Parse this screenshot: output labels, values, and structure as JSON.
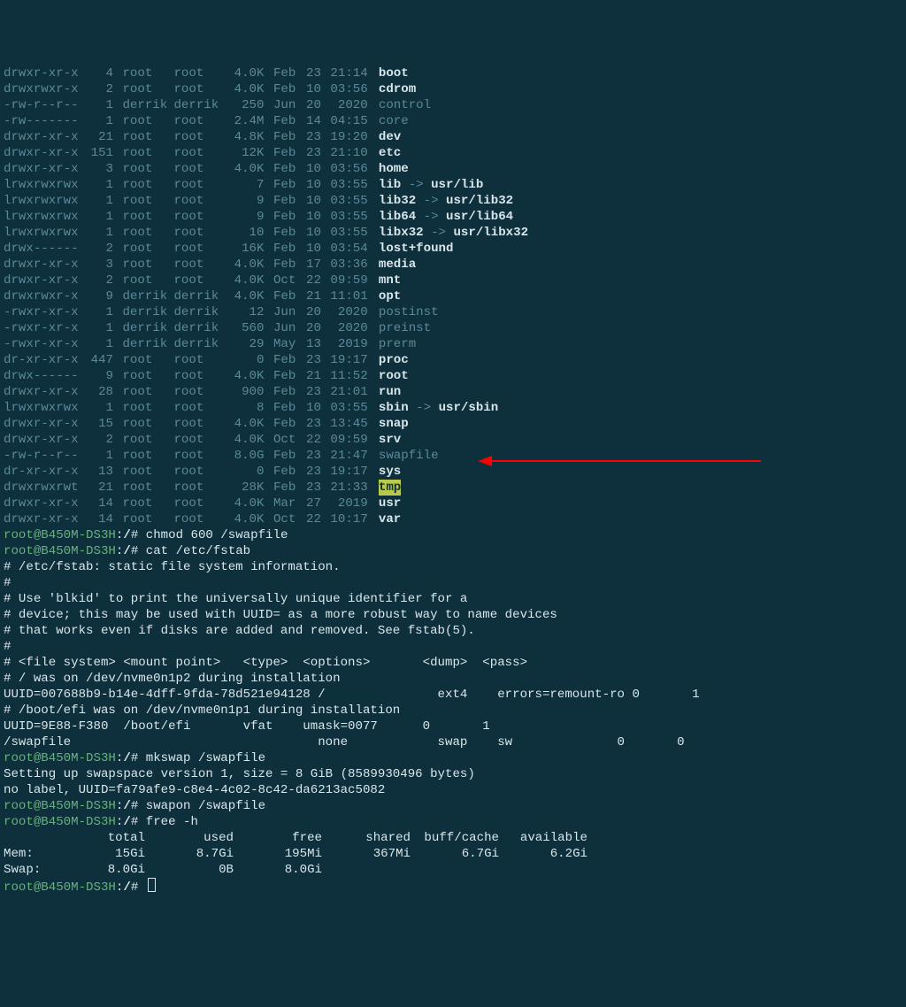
{
  "ls": [
    {
      "perm": "drwxr-xr-x",
      "links": "4",
      "owner": "root",
      "group": "root",
      "size": "4.0K",
      "mon": "Feb",
      "day": "23",
      "time": "21:14",
      "name": "boot",
      "style": "bold"
    },
    {
      "perm": "drwxrwxr-x",
      "links": "2",
      "owner": "root",
      "group": "root",
      "size": "4.0K",
      "mon": "Feb",
      "day": "10",
      "time": "03:56",
      "name": "cdrom",
      "style": "bold"
    },
    {
      "perm": "-rw-r--r--",
      "links": "1",
      "owner": "derrik",
      "group": "derrik",
      "size": "250",
      "mon": "Jun",
      "day": "20",
      "time": " 2020",
      "name": "control",
      "style": "dim"
    },
    {
      "perm": "-rw-------",
      "links": "1",
      "owner": "root",
      "group": "root",
      "size": "2.4M",
      "mon": "Feb",
      "day": "14",
      "time": "04:15",
      "name": "core",
      "style": "dim"
    },
    {
      "perm": "drwxr-xr-x",
      "links": "21",
      "owner": "root",
      "group": "root",
      "size": "4.8K",
      "mon": "Feb",
      "day": "23",
      "time": "19:20",
      "name": "dev",
      "style": "bold"
    },
    {
      "perm": "drwxr-xr-x",
      "links": "151",
      "owner": "root",
      "group": "root",
      "size": "12K",
      "mon": "Feb",
      "day": "23",
      "time": "21:10",
      "name": "etc",
      "style": "bold"
    },
    {
      "perm": "drwxr-xr-x",
      "links": "3",
      "owner": "root",
      "group": "root",
      "size": "4.0K",
      "mon": "Feb",
      "day": "10",
      "time": "03:56",
      "name": "home",
      "style": "bold"
    },
    {
      "perm": "lrwxrwxrwx",
      "links": "1",
      "owner": "root",
      "group": "root",
      "size": "7",
      "mon": "Feb",
      "day": "10",
      "time": "03:55",
      "name": "lib",
      "style": "bold",
      "target": "usr/lib"
    },
    {
      "perm": "lrwxrwxrwx",
      "links": "1",
      "owner": "root",
      "group": "root",
      "size": "9",
      "mon": "Feb",
      "day": "10",
      "time": "03:55",
      "name": "lib32",
      "style": "bold",
      "target": "usr/lib32"
    },
    {
      "perm": "lrwxrwxrwx",
      "links": "1",
      "owner": "root",
      "group": "root",
      "size": "9",
      "mon": "Feb",
      "day": "10",
      "time": "03:55",
      "name": "lib64",
      "style": "bold",
      "target": "usr/lib64"
    },
    {
      "perm": "lrwxrwxrwx",
      "links": "1",
      "owner": "root",
      "group": "root",
      "size": "10",
      "mon": "Feb",
      "day": "10",
      "time": "03:55",
      "name": "libx32",
      "style": "bold",
      "target": "usr/libx32"
    },
    {
      "perm": "drwx------",
      "links": "2",
      "owner": "root",
      "group": "root",
      "size": "16K",
      "mon": "Feb",
      "day": "10",
      "time": "03:54",
      "name": "lost+found",
      "style": "bold"
    },
    {
      "perm": "drwxr-xr-x",
      "links": "3",
      "owner": "root",
      "group": "root",
      "size": "4.0K",
      "mon": "Feb",
      "day": "17",
      "time": "03:36",
      "name": "media",
      "style": "bold"
    },
    {
      "perm": "drwxr-xr-x",
      "links": "2",
      "owner": "root",
      "group": "root",
      "size": "4.0K",
      "mon": "Oct",
      "day": "22",
      "time": "09:59",
      "name": "mnt",
      "style": "bold"
    },
    {
      "perm": "drwxrwxr-x",
      "links": "9",
      "owner": "derrik",
      "group": "derrik",
      "size": "4.0K",
      "mon": "Feb",
      "day": "21",
      "time": "11:01",
      "name": "opt",
      "style": "bold"
    },
    {
      "perm": "-rwxr-xr-x",
      "links": "1",
      "owner": "derrik",
      "group": "derrik",
      "size": "12",
      "mon": "Jun",
      "day": "20",
      "time": " 2020",
      "name": "postinst",
      "style": "dim"
    },
    {
      "perm": "-rwxr-xr-x",
      "links": "1",
      "owner": "derrik",
      "group": "derrik",
      "size": "560",
      "mon": "Jun",
      "day": "20",
      "time": " 2020",
      "name": "preinst",
      "style": "dim"
    },
    {
      "perm": "-rwxr-xr-x",
      "links": "1",
      "owner": "derrik",
      "group": "derrik",
      "size": "29",
      "mon": "May",
      "day": "13",
      "time": " 2019",
      "name": "prerm",
      "style": "dim"
    },
    {
      "perm": "dr-xr-xr-x",
      "links": "447",
      "owner": "root",
      "group": "root",
      "size": "0",
      "mon": "Feb",
      "day": "23",
      "time": "19:17",
      "name": "proc",
      "style": "bold"
    },
    {
      "perm": "drwx------",
      "links": "9",
      "owner": "root",
      "group": "root",
      "size": "4.0K",
      "mon": "Feb",
      "day": "21",
      "time": "11:52",
      "name": "root",
      "style": "bold"
    },
    {
      "perm": "drwxr-xr-x",
      "links": "28",
      "owner": "root",
      "group": "root",
      "size": "900",
      "mon": "Feb",
      "day": "23",
      "time": "21:01",
      "name": "run",
      "style": "bold"
    },
    {
      "perm": "lrwxrwxrwx",
      "links": "1",
      "owner": "root",
      "group": "root",
      "size": "8",
      "mon": "Feb",
      "day": "10",
      "time": "03:55",
      "name": "sbin",
      "style": "bold",
      "target": "usr/sbin"
    },
    {
      "perm": "drwxr-xr-x",
      "links": "15",
      "owner": "root",
      "group": "root",
      "size": "4.0K",
      "mon": "Feb",
      "day": "23",
      "time": "13:45",
      "name": "snap",
      "style": "bold"
    },
    {
      "perm": "drwxr-xr-x",
      "links": "2",
      "owner": "root",
      "group": "root",
      "size": "4.0K",
      "mon": "Oct",
      "day": "22",
      "time": "09:59",
      "name": "srv",
      "style": "bold"
    },
    {
      "perm": "-rw-r--r--",
      "links": "1",
      "owner": "root",
      "group": "root",
      "size": "8.0G",
      "mon": "Feb",
      "day": "23",
      "time": "21:47",
      "name": "swapfile",
      "style": "dim"
    },
    {
      "perm": "dr-xr-xr-x",
      "links": "13",
      "owner": "root",
      "group": "root",
      "size": "0",
      "mon": "Feb",
      "day": "23",
      "time": "19:17",
      "name": "sys",
      "style": "bold"
    },
    {
      "perm": "drwxrwxrwt",
      "links": "21",
      "owner": "root",
      "group": "root",
      "size": "28K",
      "mon": "Feb",
      "day": "23",
      "time": "21:33",
      "name": "tmp",
      "style": "hl"
    },
    {
      "perm": "drwxr-xr-x",
      "links": "14",
      "owner": "root",
      "group": "root",
      "size": "4.0K",
      "mon": "Mar",
      "day": "27",
      "time": " 2019",
      "name": "usr",
      "style": "bold"
    },
    {
      "perm": "drwxr-xr-x",
      "links": "14",
      "owner": "root",
      "group": "root",
      "size": "4.0K",
      "mon": "Oct",
      "day": "22",
      "time": "10:17",
      "name": "var",
      "style": "bold"
    }
  ],
  "prompt_host": "root@B450M-DS3H",
  "prompt_path": "/",
  "prompt_sym": "#",
  "cmd1": "chmod 600 /swapfile",
  "cmd2": "cat /etc/fstab",
  "fstab": [
    "# /etc/fstab: static file system information.",
    "#",
    "# Use 'blkid' to print the universally unique identifier for a",
    "# device; this may be used with UUID= as a more robust way to name devices",
    "# that works even if disks are added and removed. See fstab(5).",
    "#",
    "# <file system> <mount point>   <type>  <options>       <dump>  <pass>",
    "# / was on /dev/nvme0n1p2 during installation",
    "UUID=007688b9-b14e-4dff-9fda-78d521e94128 /               ext4    errors=remount-ro 0       1",
    "# /boot/efi was on /dev/nvme0n1p1 during installation",
    "UUID=9E88-F380  /boot/efi       vfat    umask=0077      0       1",
    "/swapfile                                 none            swap    sw              0       0"
  ],
  "cmd3": "mkswap /swapfile",
  "mkswap_out": [
    "Setting up swapspace version 1, size = 8 GiB (8589930496 bytes)",
    "no label, UUID=fa79afe9-c8e4-4c02-8c42-da6213ac5082"
  ],
  "cmd4": "swapon /swapfile",
  "cmd5": "free -h",
  "free": {
    "hdr": [
      "total",
      "used",
      "free",
      "shared",
      "buff/cache",
      "available"
    ],
    "mem": {
      "label": "Mem:",
      "cols": [
        "15Gi",
        "8.7Gi",
        "195Mi",
        "367Mi",
        "6.7Gi",
        "6.2Gi"
      ]
    },
    "swap": {
      "label": "Swap:",
      "cols": [
        "8.0Gi",
        "0B",
        "8.0Gi",
        "",
        "",
        ""
      ]
    }
  }
}
